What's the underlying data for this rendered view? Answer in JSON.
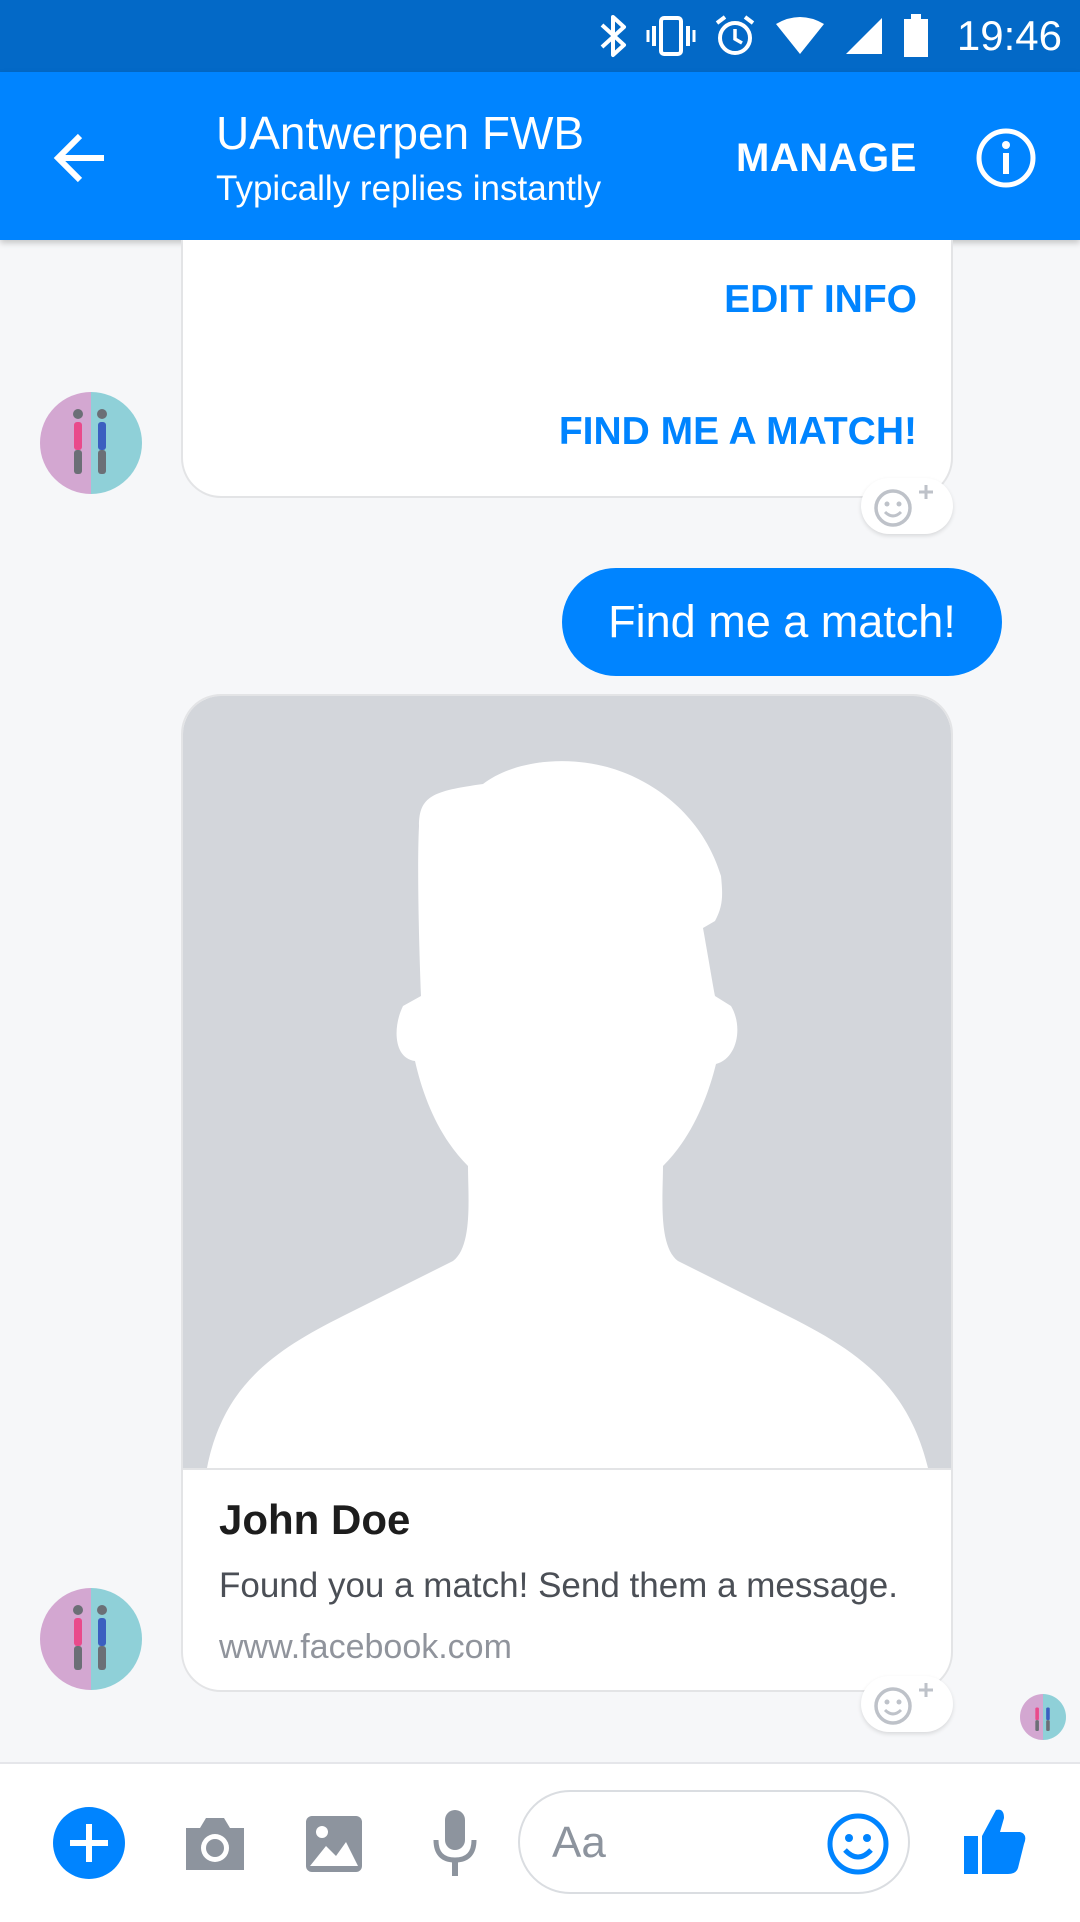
{
  "status_bar": {
    "time": "19:46",
    "icons": [
      "bluetooth-icon",
      "vibrate-icon",
      "alarm-icon",
      "wifi-icon",
      "signal-icon",
      "battery-icon"
    ]
  },
  "header": {
    "title": "UAntwerpen FWB",
    "subtitle": "Typically replies instantly",
    "manage_label": "MANAGE",
    "back_icon": "arrow-left-icon",
    "info_icon": "info-icon"
  },
  "messages": {
    "card1": {
      "buttons": [
        "EDIT INFO",
        "FIND ME A MATCH!"
      ]
    },
    "outgoing": {
      "text": "Find me a match!"
    },
    "card2": {
      "name": "John Doe",
      "description": "Found you a match! Send them a message.",
      "url": "www.facebook.com"
    }
  },
  "composer": {
    "placeholder": "Aa",
    "icons": [
      "plus-icon",
      "camera-icon",
      "image-icon",
      "microphone-icon",
      "emoji-icon",
      "thumbs-up-icon"
    ]
  },
  "colors": {
    "status_bar": "#0369c7",
    "header": "#0084ff",
    "accent": "#0084ff",
    "background": "#f6f7f9"
  }
}
